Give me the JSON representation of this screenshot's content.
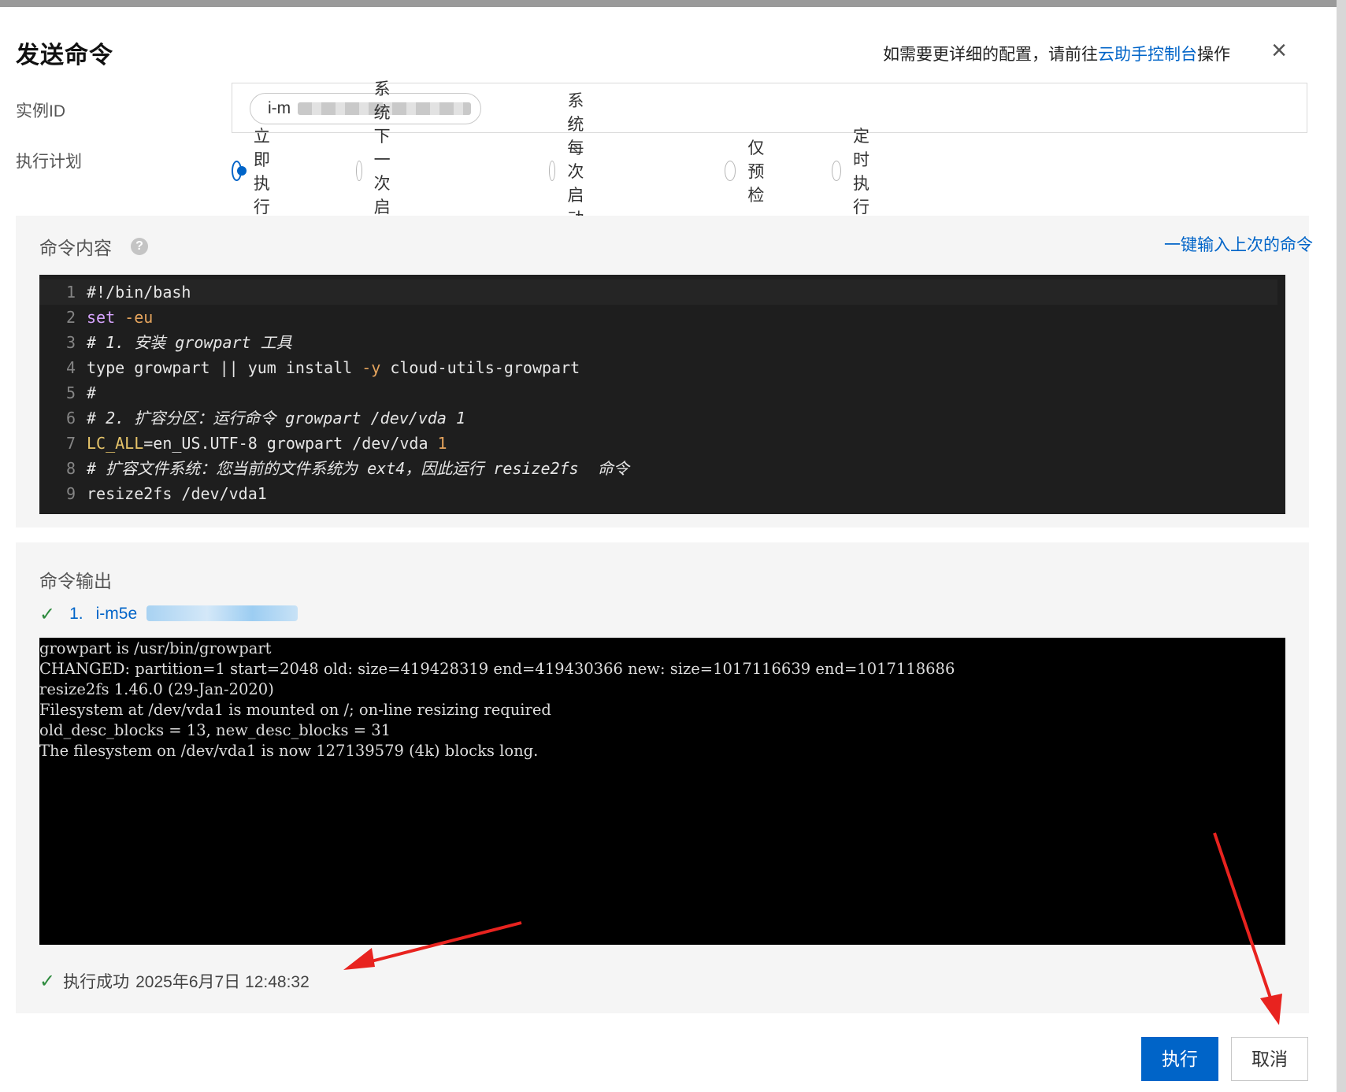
{
  "dialog": {
    "title": "发送命令",
    "hint_prefix": "如需要更详细的配置，请前往",
    "hint_link": "云助手控制台",
    "hint_suffix": "操作",
    "close_icon": "×"
  },
  "instance": {
    "label": "实例ID",
    "tag_prefix": "i-m"
  },
  "schedule": {
    "label": "执行计划",
    "options": [
      "立即执行",
      "系统下一次启动后",
      "系统每次启动后",
      "仅预检",
      "定时执行"
    ],
    "selected": "立即执行"
  },
  "command": {
    "title": "命令内容",
    "help_icon": "?",
    "last_command_link": "一键输入上次的命令",
    "line_numbers": [
      "1",
      "2",
      "3",
      "4",
      "5",
      "6",
      "7",
      "8",
      "9"
    ],
    "lines": [
      "#!/bin/bash",
      "set -eu",
      "# 1. 安装 growpart 工具",
      "type growpart || yum install -y cloud-utils-growpart",
      "#",
      "# 2. 扩容分区：运行命令 growpart /dev/vda 1",
      "LC_ALL=en_US.UTF-8 growpart /dev/vda 1",
      "# 扩容文件系统：您当前的文件系统为 ext4，因此运行 resize2fs  命令",
      "resize2fs /dev/vda1"
    ]
  },
  "output": {
    "title": "命令输出",
    "item_index": "1.",
    "item_id_prefix": "i-m5e",
    "check_icon": "✓",
    "terminal_lines": [
      "growpart is /usr/bin/growpart",
      "CHANGED: partition=1 start=2048 old: size=419428319 end=419430366 new: size=1017116639 end=1017118686",
      "resize2fs 1.46.0 (29-Jan-2020)",
      "Filesystem at /dev/vda1 is mounted on /; on-line resizing required",
      "old_desc_blocks = 13, new_desc_blocks = 31",
      "The filesystem on /dev/vda1 is now 127139579 (4k) blocks long."
    ],
    "status_text": "执行成功",
    "status_time": "2025年6月7日 12:48:32"
  },
  "footer": {
    "execute_label": "执行",
    "cancel_label": "取消"
  },
  "colors": {
    "primary": "#0064c8",
    "success": "#2e8b3e",
    "annotation_arrow": "#e8231f"
  }
}
